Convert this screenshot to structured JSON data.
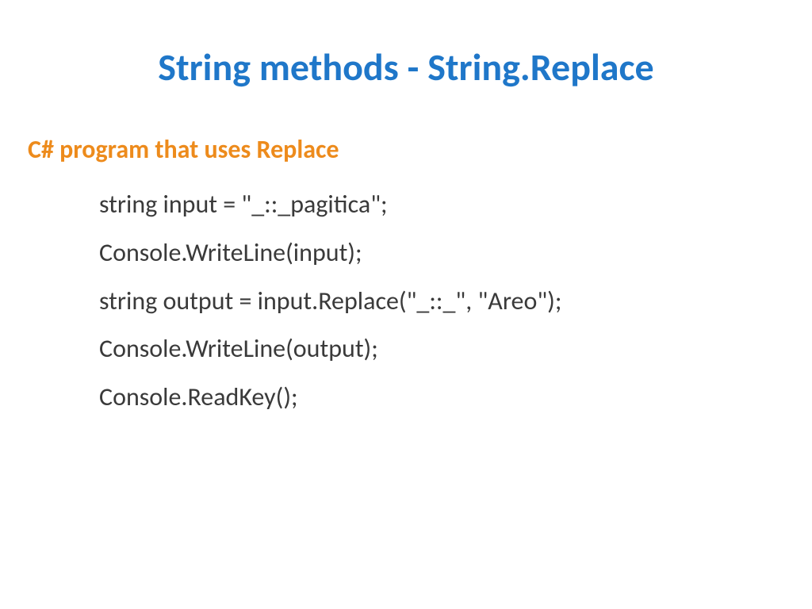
{
  "title": "String methods - String.Replace",
  "subtitle": "C# program that uses Replace",
  "code": {
    "line1": "string input = \"_::_pagitica\";",
    "line2": "Console.WriteLine(input);",
    "line3": "string output = input.Replace(\"_::_\", \"Areo\");",
    "line4": "Console.WriteLine(output);",
    "line5": "Console.ReadKey();"
  }
}
